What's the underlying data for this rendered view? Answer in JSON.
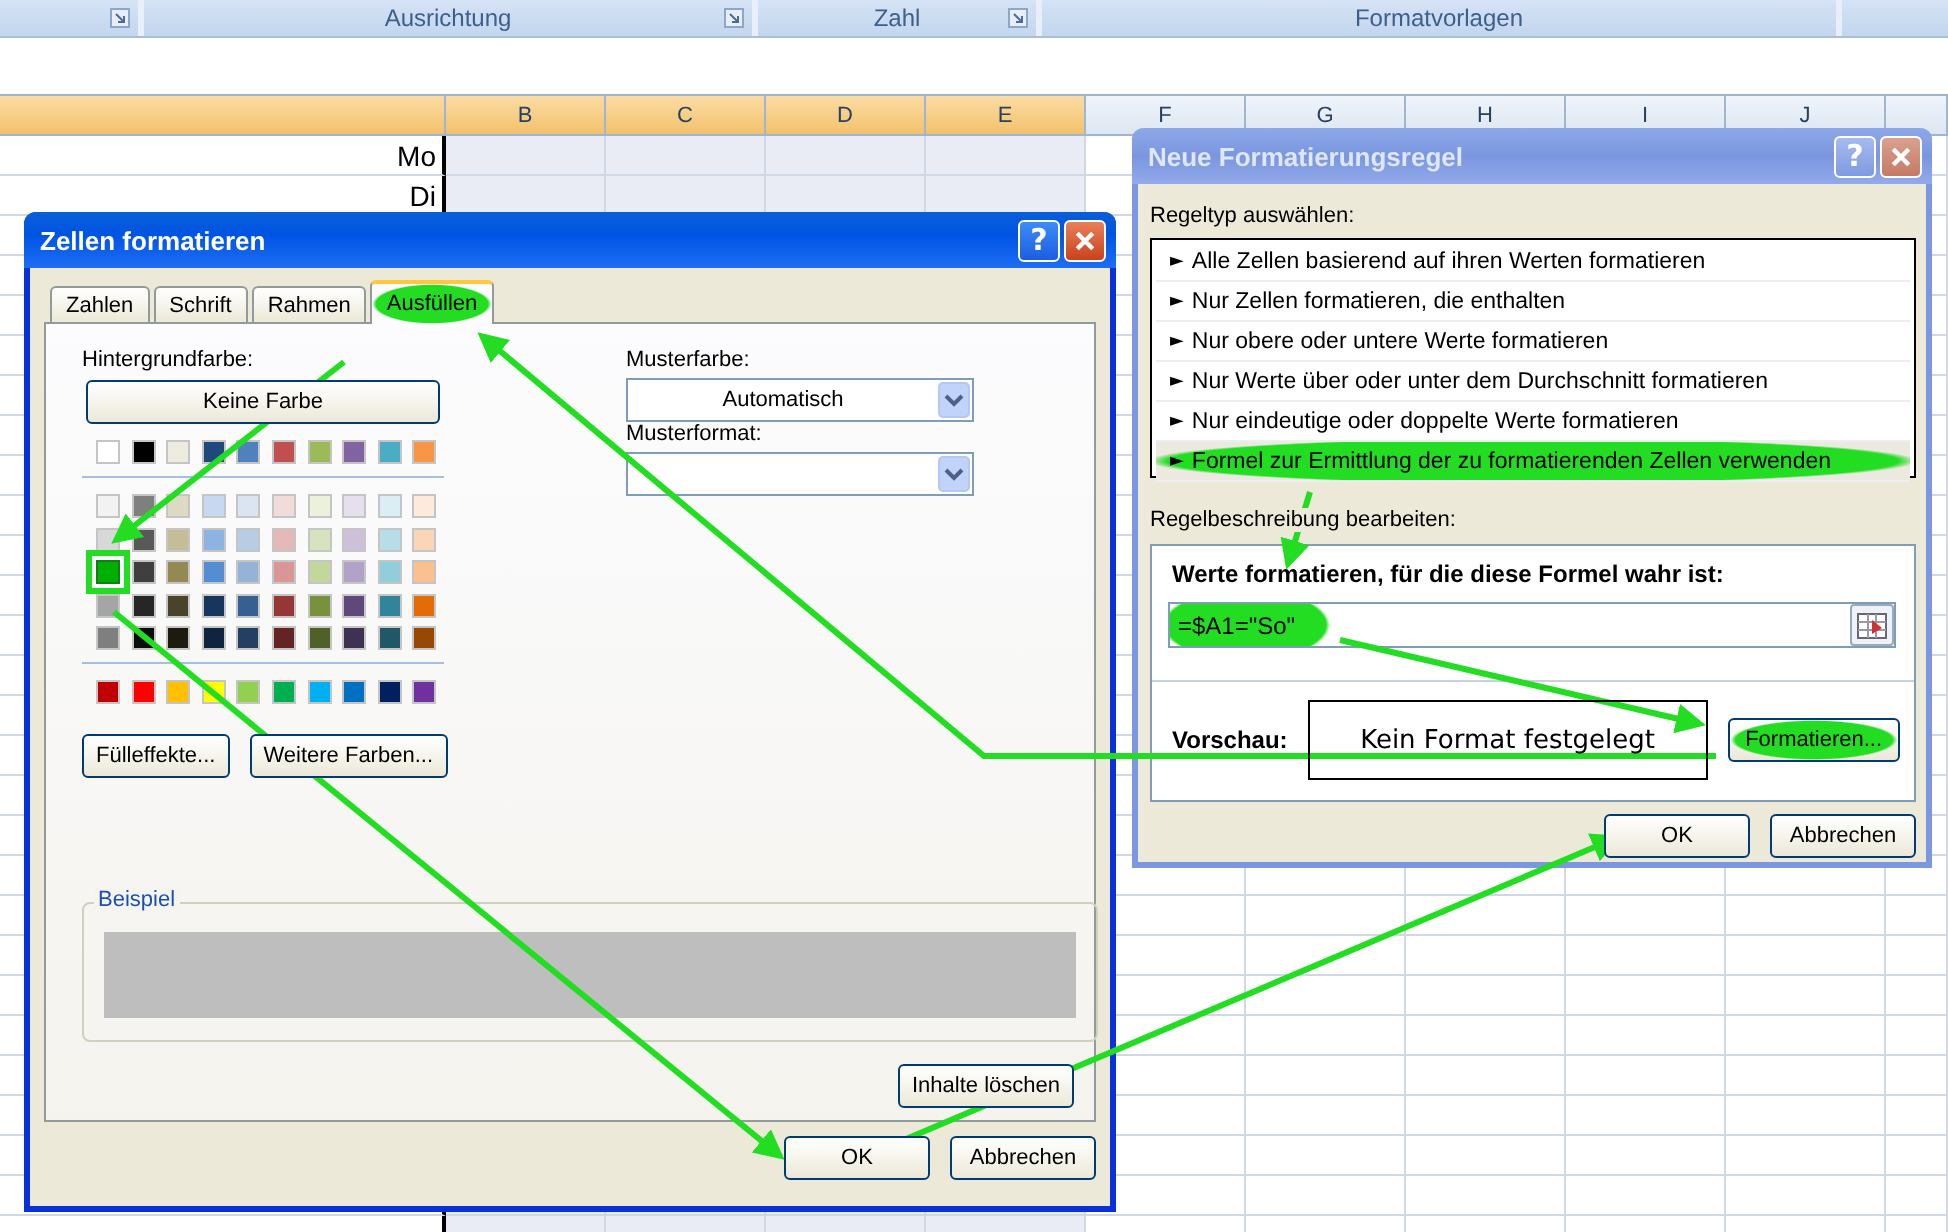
{
  "ribbon": {
    "groups": [
      {
        "label": "Ausrichtung",
        "launcher": true
      },
      {
        "label": "Zahl",
        "launcher": true
      },
      {
        "label": "Formatvorlagen",
        "launcher": false
      }
    ]
  },
  "sheet": {
    "first_column_selected": true,
    "columns": [
      {
        "label": "B",
        "selected": true
      },
      {
        "label": "C",
        "selected": true
      },
      {
        "label": "D",
        "selected": true
      },
      {
        "label": "E",
        "selected": true
      },
      {
        "label": "F",
        "selected": false
      },
      {
        "label": "G",
        "selected": false
      },
      {
        "label": "H",
        "selected": false
      },
      {
        "label": "I",
        "selected": false
      },
      {
        "label": "J",
        "selected": false
      }
    ],
    "rows": [
      {
        "label": "Mo"
      },
      {
        "label": "Di"
      }
    ]
  },
  "format_cells_dialog": {
    "title": "Zellen formatieren",
    "help": "?",
    "tabs": [
      {
        "label": "Zahlen",
        "selected": false,
        "highlighted": false
      },
      {
        "label": "Schrift",
        "selected": false,
        "highlighted": false
      },
      {
        "label": "Rahmen",
        "selected": false,
        "highlighted": false
      },
      {
        "label": "Ausfüllen",
        "selected": true,
        "highlighted": true
      }
    ],
    "background_color_label": "Hintergrundfarbe:",
    "no_color_button": "Keine Farbe",
    "theme_colors": [
      {
        "color": "#ffffff",
        "selected": false
      },
      {
        "color": "#000000",
        "selected": false
      },
      {
        "color": "#eeece1",
        "selected": false
      },
      {
        "color": "#1f497d",
        "selected": false
      },
      {
        "color": "#4f81bd",
        "selected": false
      },
      {
        "color": "#c0504d",
        "selected": false
      },
      {
        "color": "#9bbb59",
        "selected": false
      },
      {
        "color": "#8064a2",
        "selected": false
      },
      {
        "color": "#4bacc6",
        "selected": false
      },
      {
        "color": "#f79646",
        "selected": false
      }
    ],
    "shade_rows": [
      {
        "swatches": [
          {
            "color": "#f2f2f2",
            "selected": false
          },
          {
            "color": "#7f7f7f",
            "selected": false
          },
          {
            "color": "#ddd9c3",
            "selected": false
          },
          {
            "color": "#c6d9f0",
            "selected": false
          },
          {
            "color": "#dbe5f1",
            "selected": false
          },
          {
            "color": "#f2dcdb",
            "selected": false
          },
          {
            "color": "#ebf1dd",
            "selected": false
          },
          {
            "color": "#e5e0ec",
            "selected": false
          },
          {
            "color": "#dbeef3",
            "selected": false
          },
          {
            "color": "#fdeada",
            "selected": false
          }
        ]
      },
      {
        "swatches": [
          {
            "color": "#d8d8d8",
            "selected": false
          },
          {
            "color": "#595959",
            "selected": false
          },
          {
            "color": "#c4bd97",
            "selected": false
          },
          {
            "color": "#8db3e2",
            "selected": false
          },
          {
            "color": "#b8cce4",
            "selected": false
          },
          {
            "color": "#e5b9b7",
            "selected": false
          },
          {
            "color": "#d7e3bc",
            "selected": false
          },
          {
            "color": "#ccc1d9",
            "selected": false
          },
          {
            "color": "#b7dde8",
            "selected": false
          },
          {
            "color": "#fbd5b5",
            "selected": false
          }
        ]
      },
      {
        "swatches": [
          {
            "color": "#00b000",
            "selected": true
          },
          {
            "color": "#3f3f3f",
            "selected": false
          },
          {
            "color": "#938953",
            "selected": false
          },
          {
            "color": "#548dd4",
            "selected": false
          },
          {
            "color": "#95b3d7",
            "selected": false
          },
          {
            "color": "#d99694",
            "selected": false
          },
          {
            "color": "#c3d69b",
            "selected": false
          },
          {
            "color": "#b2a2c7",
            "selected": false
          },
          {
            "color": "#92cddc",
            "selected": false
          },
          {
            "color": "#fac08f",
            "selected": false
          }
        ]
      },
      {
        "swatches": [
          {
            "color": "#a5a5a5",
            "selected": false
          },
          {
            "color": "#262626",
            "selected": false
          },
          {
            "color": "#494429",
            "selected": false
          },
          {
            "color": "#17365d",
            "selected": false
          },
          {
            "color": "#366092",
            "selected": false
          },
          {
            "color": "#953734",
            "selected": false
          },
          {
            "color": "#76923c",
            "selected": false
          },
          {
            "color": "#5f497a",
            "selected": false
          },
          {
            "color": "#31859b",
            "selected": false
          },
          {
            "color": "#e36c09",
            "selected": false
          }
        ]
      },
      {
        "swatches": [
          {
            "color": "#7f7f7f",
            "selected": false
          },
          {
            "color": "#0c0c0c",
            "selected": false
          },
          {
            "color": "#1d1b10",
            "selected": false
          },
          {
            "color": "#0f243e",
            "selected": false
          },
          {
            "color": "#244061",
            "selected": false
          },
          {
            "color": "#632423",
            "selected": false
          },
          {
            "color": "#4f6128",
            "selected": false
          },
          {
            "color": "#3f3151",
            "selected": false
          },
          {
            "color": "#205867",
            "selected": false
          },
          {
            "color": "#974806",
            "selected": false
          }
        ]
      }
    ],
    "standard_colors": [
      {
        "color": "#c00000",
        "selected": false
      },
      {
        "color": "#ff0000",
        "selected": false
      },
      {
        "color": "#ffc000",
        "selected": false
      },
      {
        "color": "#ffff00",
        "selected": false
      },
      {
        "color": "#92d050",
        "selected": false
      },
      {
        "color": "#00b050",
        "selected": false
      },
      {
        "color": "#00b0f0",
        "selected": false
      },
      {
        "color": "#0070c0",
        "selected": false
      },
      {
        "color": "#002060",
        "selected": false
      },
      {
        "color": "#7030a0",
        "selected": false
      }
    ],
    "fill_effects_button": "Fülleffekte...",
    "more_colors_button": "Weitere Farben...",
    "pattern_color_label": "Musterfarbe:",
    "pattern_color_value": "Automatisch",
    "pattern_style_label": "Musterformat:",
    "sample_label": "Beispiel",
    "clear_button": "Inhalte löschen",
    "ok_button": "OK",
    "cancel_button": "Abbrechen"
  },
  "new_rule_dialog": {
    "title": "Neue Formatierungsregel",
    "help": "?",
    "rule_type_label": "Regeltyp auswählen:",
    "rule_types": [
      {
        "marker": "►",
        "label": "Alle Zellen basierend auf ihren Werten formatieren",
        "selected": false,
        "highlighted": false
      },
      {
        "marker": "►",
        "label": "Nur Zellen formatieren, die enthalten",
        "selected": false,
        "highlighted": false
      },
      {
        "marker": "►",
        "label": "Nur obere oder untere Werte formatieren",
        "selected": false,
        "highlighted": false
      },
      {
        "marker": "►",
        "label": "Nur Werte über oder unter dem Durchschnitt formatieren",
        "selected": false,
        "highlighted": false
      },
      {
        "marker": "►",
        "label": "Nur eindeutige oder doppelte Werte formatieren",
        "selected": false,
        "highlighted": false
      },
      {
        "marker": "►",
        "label": "Formel zur Ermittlung der zu formatierenden Zellen verwenden",
        "selected": true,
        "highlighted": true
      }
    ],
    "description_label": "Regelbeschreibung bearbeiten:",
    "formula_heading": "Werte formatieren, für die diese Formel wahr ist:",
    "formula": {
      "value": "=$A1=\"So\"",
      "highlighted": true
    },
    "preview_label": "Vorschau:",
    "preview_text": "Kein Format festgelegt",
    "format_button": {
      "label": "Formatieren...",
      "highlighted": true
    },
    "ok_button": "OK",
    "cancel_button": "Abbrechen"
  }
}
